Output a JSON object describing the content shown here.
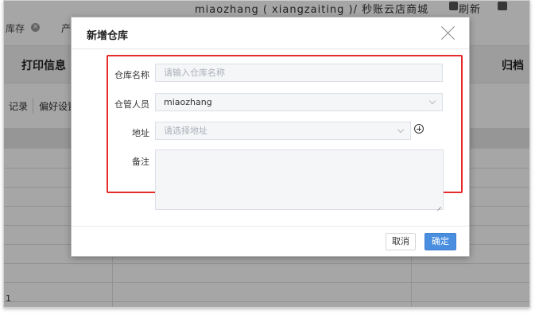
{
  "background": {
    "top_user": "miaozhang ( xiangzaiting )/ 秒账云店商城",
    "top_refresh": "刷新",
    "tab_inventory": "库存",
    "tab_product": "产",
    "print_info": "打印信息",
    "archive": "归档",
    "sub_records": "记录",
    "sub_preferences": "偏好设置",
    "bottom_number": "1"
  },
  "modal": {
    "title": "新增仓库",
    "fields": {
      "warehouse_name_label": "仓库名称",
      "warehouse_name_placeholder": "请输入仓库名称",
      "manager_label": "仓管人员",
      "manager_value": "miaozhang",
      "address_label": "地址",
      "address_placeholder": "请选择地址",
      "remark_label": "备注"
    },
    "buttons": {
      "cancel": "取消",
      "confirm": "确定"
    }
  },
  "colors": {
    "highlight_border": "#e62b2b",
    "primary_button": "#4a8ee0"
  }
}
